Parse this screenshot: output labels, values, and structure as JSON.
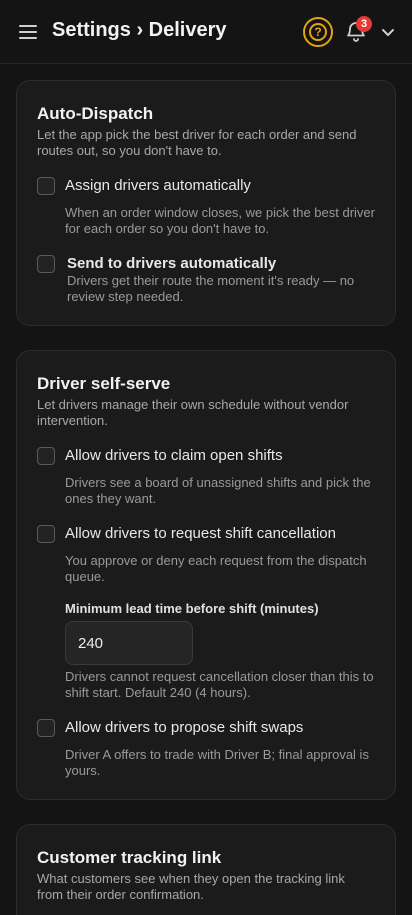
{
  "header": {
    "title": "Settings › Delivery",
    "notification_count": "3",
    "accent": "#e3a313",
    "badge_color": "#e53935"
  },
  "auto_dispatch": {
    "title": "Auto-Dispatch",
    "description": "Let the app pick the best driver for each order and send routes out, so you don't have to.",
    "options": [
      {
        "label": "Assign drivers automatically",
        "help": "When an order window closes, we pick the best driver for each order so you don't have to.",
        "checked": false
      },
      {
        "label": "Send to drivers automatically",
        "help": "Drivers get their route the moment it's ready — no review step needed.",
        "checked": false
      }
    ]
  },
  "driver_self_serve": {
    "title": "Driver self-serve",
    "description": "Let drivers manage their own schedule without vendor intervention.",
    "options": [
      {
        "label": "Allow drivers to claim open shifts",
        "help": "Drivers see a board of unassigned shifts and pick the ones they want.",
        "checked": false
      },
      {
        "label": "Allow drivers to request shift cancellation",
        "help": "You approve or deny each request from the dispatch queue.",
        "checked": false
      },
      {
        "label": "Allow drivers to propose shift swaps",
        "help": "Driver A offers to trade with Driver B; final approval is yours.",
        "checked": false
      }
    ],
    "lead_time": {
      "label": "Minimum lead time before shift (minutes)",
      "value": "240",
      "help": "Drivers cannot request cancellation closer than this to shift start. Default 240 (4 hours)."
    }
  },
  "customer_tracking": {
    "title": "Customer tracking link",
    "description": "What customers see when they open the tracking link from their order confirmation."
  }
}
